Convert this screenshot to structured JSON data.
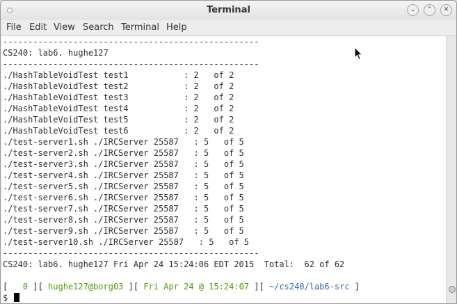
{
  "window": {
    "title": "Terminal",
    "buttons": {
      "minimize": "⌄",
      "maximize": "⌃",
      "close": "✕"
    }
  },
  "menubar": [
    "File",
    "Edit",
    "View",
    "Search",
    "Terminal",
    "Help"
  ],
  "terminal": {
    "lines": [
      "---------------------------------------------------",
      "CS240: lab6. hughe127",
      "---------------------------------------------------",
      "./HashTableVoidTest test1           : 2   of 2",
      "./HashTableVoidTest test2           : 2   of 2",
      "./HashTableVoidTest test3           : 2   of 2",
      "./HashTableVoidTest test4           : 2   of 2",
      "./HashTableVoidTest test5           : 2   of 2",
      "./HashTableVoidTest test6           : 2   of 2",
      "./test-server1.sh ./IRCServer 25587   : 5   of 5",
      "./test-server2.sh ./IRCServer 25587   : 5   of 5",
      "./test-server3.sh ./IRCServer 25587   : 5   of 5",
      "./test-server4.sh ./IRCServer 25587   : 5   of 5",
      "./test-server5.sh ./IRCServer 25587   : 5   of 5",
      "./test-server6.sh ./IRCServer 25587   : 5   of 5",
      "./test-server7.sh ./IRCServer 25587   : 5   of 5",
      "./test-server8.sh ./IRCServer 25587   : 5   of 5",
      "./test-server9.sh ./IRCServer 25587   : 5   of 5",
      "./test-server10.sh ./IRCServer 25587   : 5   of 5",
      "---------------------------------------------------",
      "CS240: lab6. hughe127 Fri Apr 24 15:24:06 EDT 2015  Total:  62 of 62",
      ""
    ],
    "prompt": {
      "open": "[",
      "exit_code": "   0",
      "sep1": " ][ ",
      "user_host": "hughe127@borg03",
      "sep2": " ][ ",
      "datetime": "Fri Apr 24 @ 15:24:07",
      "sep3": " ][ ",
      "cwd": "~/cs240/lab6-src",
      "close": " ]",
      "symbol": "$ "
    },
    "colors": {
      "green": "#4e9a06",
      "blue": "#3465a4"
    }
  }
}
